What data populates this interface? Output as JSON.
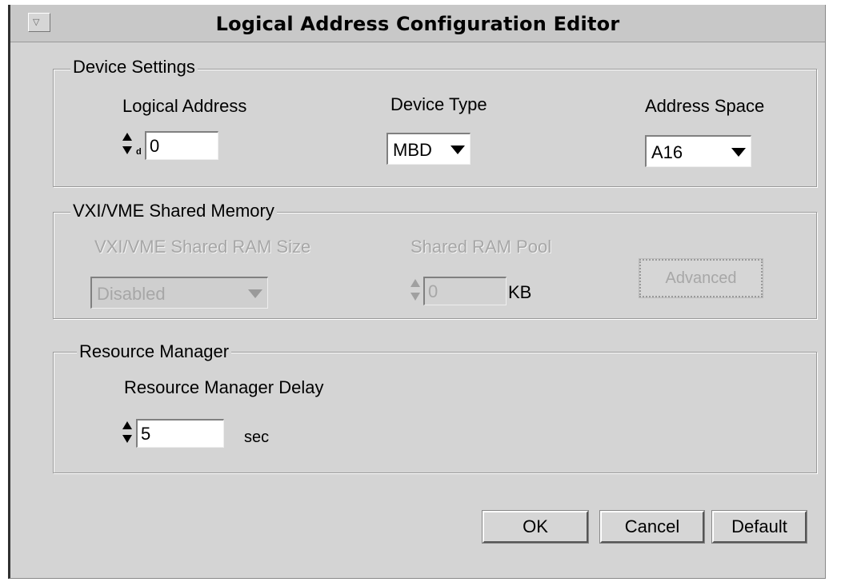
{
  "window": {
    "title": "Logical Address Configuration Editor",
    "system_menu_glyph": "▽"
  },
  "device_settings": {
    "legend": "Device Settings",
    "logical_address_label": "Logical Address",
    "logical_address_radix": "d",
    "logical_address_value": "0",
    "device_type_label": "Device Type",
    "device_type_value": "MBD",
    "address_space_label": "Address Space",
    "address_space_value": "A16"
  },
  "shared_memory": {
    "legend": "VXI/VME Shared Memory",
    "ram_size_label": "VXI/VME Shared RAM Size",
    "ram_size_value": "Disabled",
    "pool_label": "Shared RAM Pool",
    "pool_value": "0",
    "pool_unit": "KB",
    "advanced_label": "Advanced"
  },
  "resource_manager": {
    "legend": "Resource Manager",
    "delay_label": "Resource Manager Delay",
    "delay_value": "5",
    "delay_unit": "sec"
  },
  "buttons": {
    "ok": "OK",
    "cancel": "Cancel",
    "default": "Default"
  }
}
